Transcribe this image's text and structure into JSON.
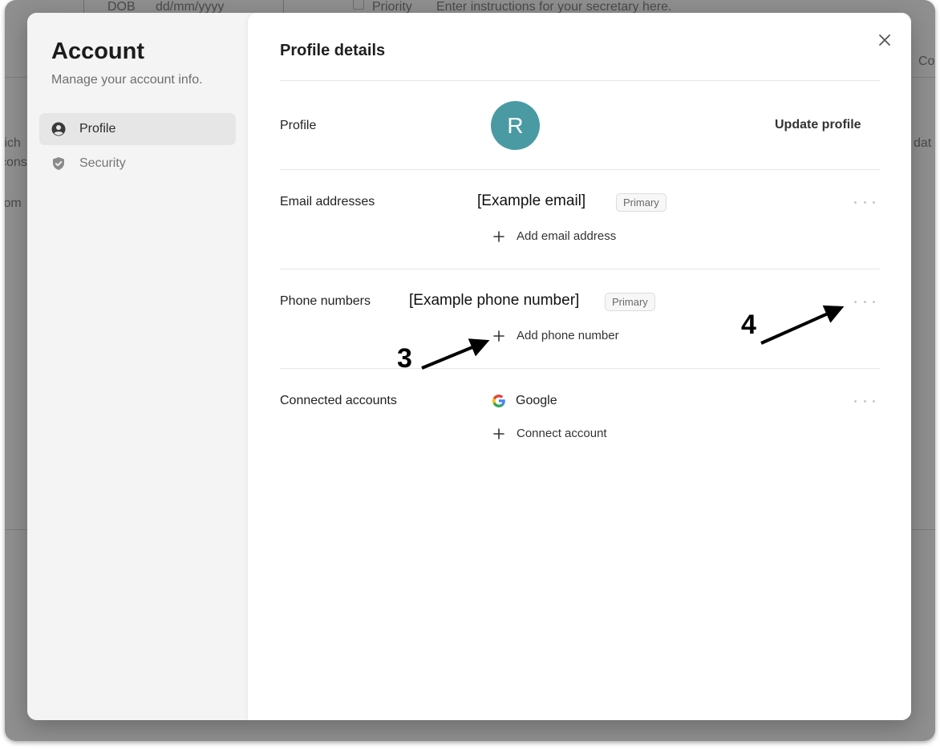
{
  "background": {
    "dob_label": "DOB",
    "dob_placeholder": "dd/mm/yyyy",
    "priority_label": "Priority",
    "instructions_placeholder": "Enter instructions for your secretary here.",
    "fragment_rich": "rich",
    "fragment_cons": "cons",
    "fragment_tom": "tom",
    "fragment_co": "Co",
    "fragment_dat": "dat"
  },
  "sidebar": {
    "title": "Account",
    "subtitle": "Manage your account info.",
    "items": [
      {
        "label": "Profile",
        "icon": "user-circle-icon",
        "active": true
      },
      {
        "label": "Security",
        "icon": "shield-check-icon",
        "active": false
      }
    ]
  },
  "content": {
    "title": "Profile details",
    "close_icon": "close-icon",
    "profile": {
      "label": "Profile",
      "avatar_initial": "R",
      "avatar_color": "#4a9aa4",
      "update_label": "Update profile"
    },
    "email": {
      "label": "Email addresses",
      "value": "[Example email]",
      "badge": "Primary",
      "add_label": "Add email address"
    },
    "phone": {
      "label": "Phone numbers",
      "value": "[Example phone number]",
      "badge": "Primary",
      "add_label": "Add phone number"
    },
    "connected": {
      "label": "Connected accounts",
      "provider": "Google",
      "add_label": "Connect account"
    }
  },
  "annotations": {
    "label_3": "3",
    "label_4": "4"
  }
}
